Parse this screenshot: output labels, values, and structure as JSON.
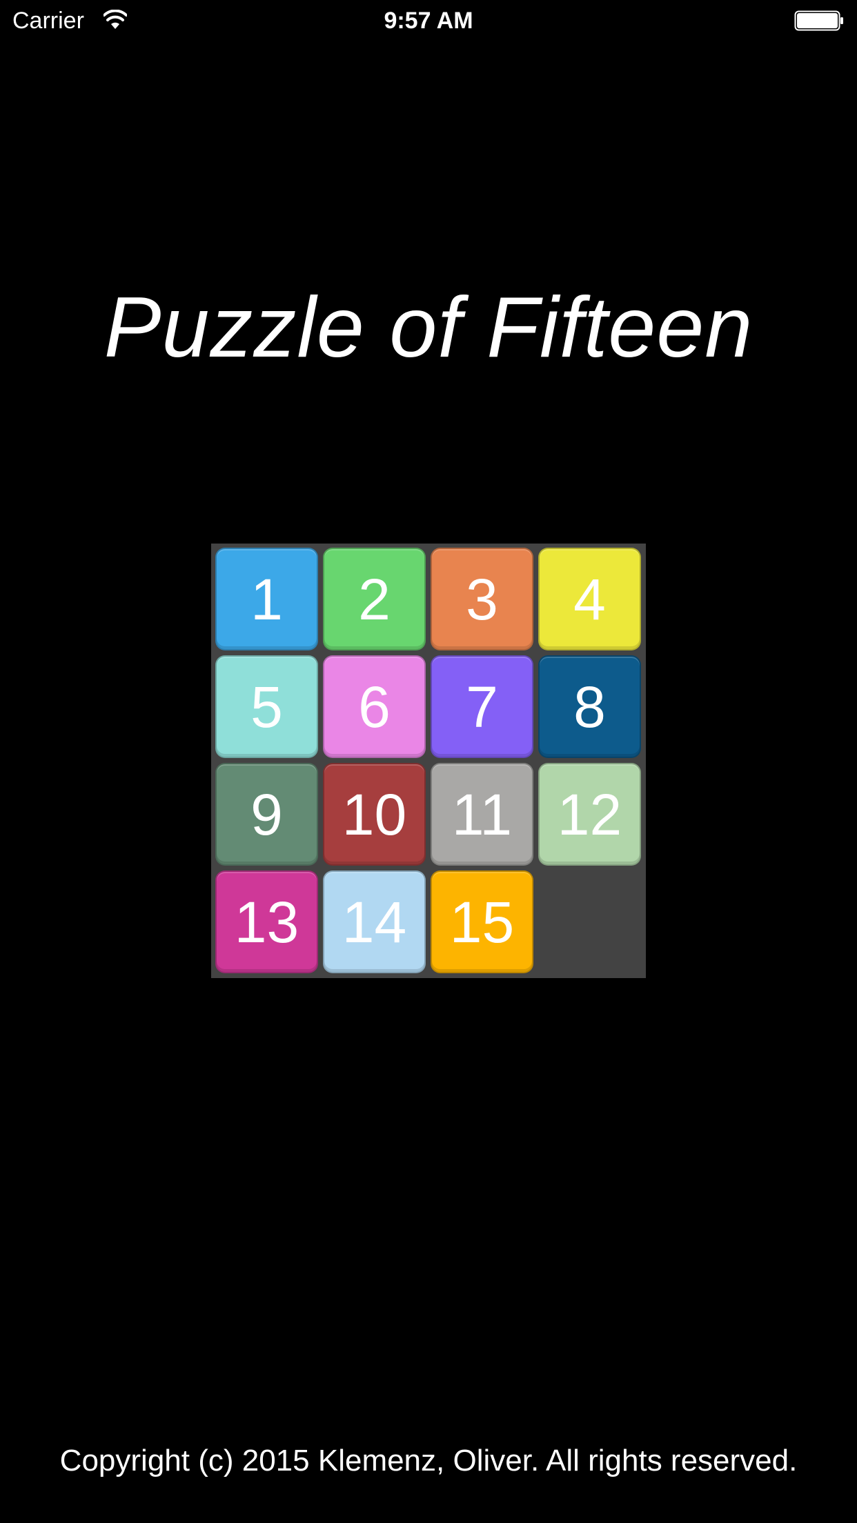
{
  "status_bar": {
    "carrier": "Carrier",
    "time": "9:57 AM",
    "wifi_icon": "wifi-icon",
    "battery_icon": "battery-icon"
  },
  "title": "Puzzle of Fifteen",
  "board": {
    "background_color": "#434343",
    "tiles": [
      {
        "label": "1",
        "color": "#3ca8e8"
      },
      {
        "label": "2",
        "color": "#68d66f"
      },
      {
        "label": "3",
        "color": "#e8844f"
      },
      {
        "label": "4",
        "color": "#ece83a"
      },
      {
        "label": "5",
        "color": "#8fdfd9"
      },
      {
        "label": "6",
        "color": "#ea86e6"
      },
      {
        "label": "7",
        "color": "#8460f6"
      },
      {
        "label": "8",
        "color": "#0d5b8c"
      },
      {
        "label": "9",
        "color": "#638b74"
      },
      {
        "label": "10",
        "color": "#a63e3e"
      },
      {
        "label": "11",
        "color": "#a9a8a6"
      },
      {
        "label": "12",
        "color": "#b1d6aa"
      },
      {
        "label": "13",
        "color": "#cf3898"
      },
      {
        "label": "14",
        "color": "#b1d8f2"
      },
      {
        "label": "15",
        "color": "#fdb400"
      }
    ],
    "empty_slot": true
  },
  "footer": {
    "copyright": "Copyright (c) 2015 Klemenz, Oliver. All rights reserved."
  }
}
